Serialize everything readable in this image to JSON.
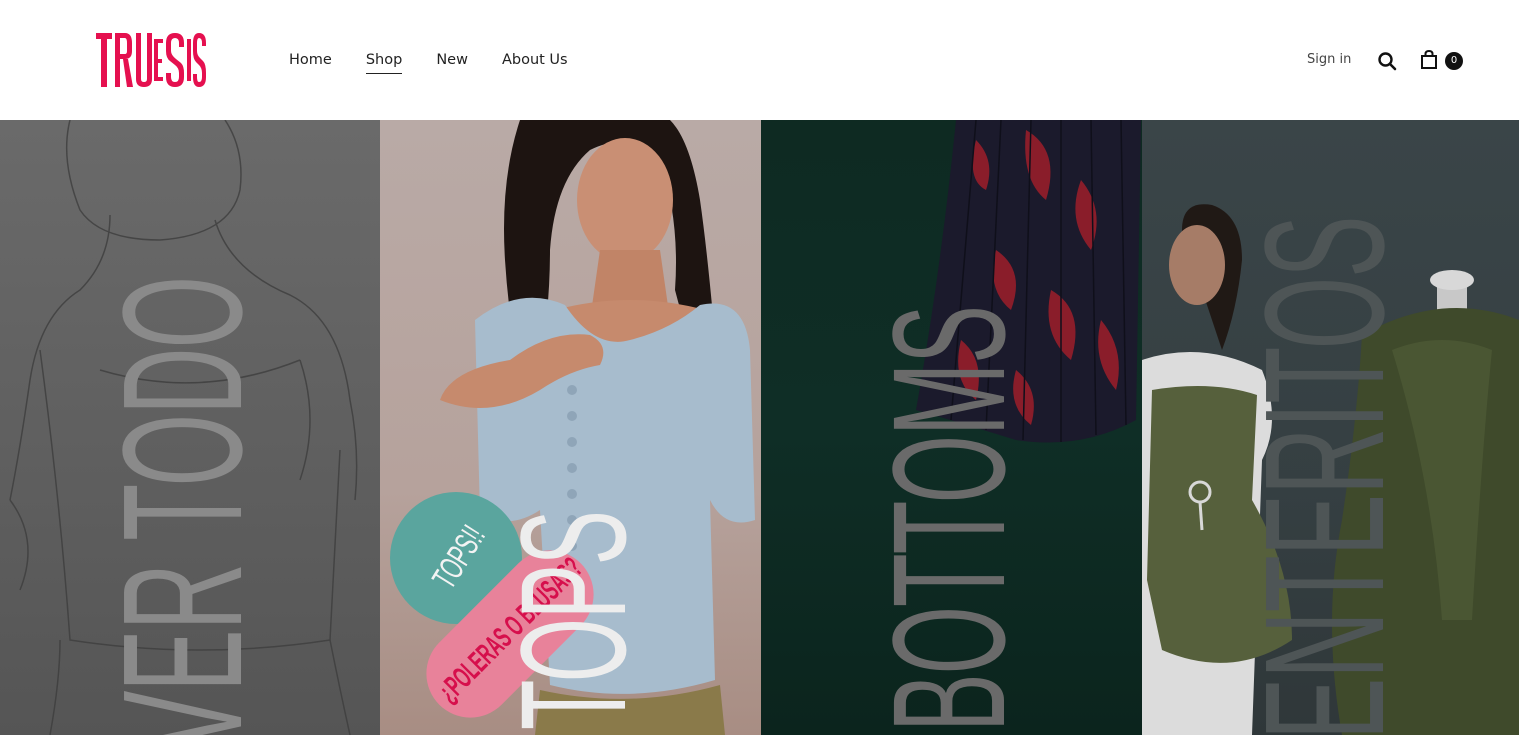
{
  "header": {
    "logo_text": "TRUESIS",
    "brand_color": "#e5104f",
    "nav": [
      {
        "label": "Home",
        "active": false
      },
      {
        "label": "Shop",
        "active": true
      },
      {
        "label": "New",
        "active": false
      },
      {
        "label": "About Us",
        "active": false
      }
    ],
    "signin_label": "Sign in",
    "cart_count": "0"
  },
  "panels": [
    {
      "label": "VER TODO",
      "icon": "sketch-image"
    },
    {
      "label": "TOPS",
      "sticker_top": "TOPS!!",
      "sticker_bottom": "¿POLERAS O BLUSAS?",
      "icon": "model-photo"
    },
    {
      "label": "BOTTOMS",
      "icon": "skirt-photo"
    },
    {
      "label": "ENTERITOS",
      "icon": "dress-photo"
    }
  ]
}
